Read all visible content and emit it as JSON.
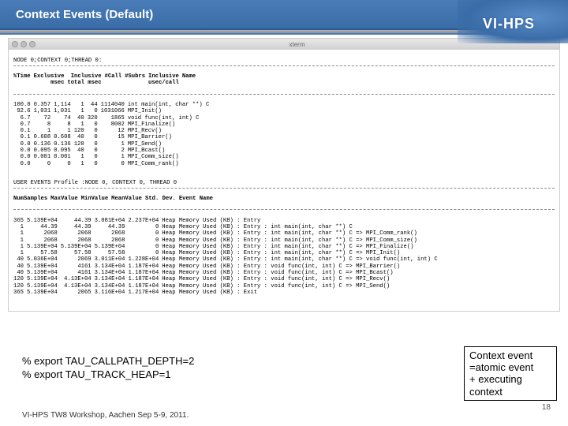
{
  "header": {
    "title": "Context Events (Default)"
  },
  "logo": {
    "text": "VI-HPS"
  },
  "xterm": {
    "window_title": "xterm",
    "node_line": "NODE 0;CONTEXT 0;THREAD 0:",
    "cols1": [
      "%Time",
      "Exclusive",
      "Inclusive",
      "#Call",
      "#Subrs",
      "Inclusive",
      "Name"
    ],
    "cols1b": [
      "",
      "msec",
      "total msec",
      "",
      "",
      "usec/call",
      ""
    ],
    "rows1": [
      [
        "100.0",
        "0.357",
        "1,114",
        "1",
        "44",
        "1114040",
        "int main(int, char **) C"
      ],
      [
        "92.6",
        "1,031",
        "1,031",
        "1",
        "0",
        "1031066",
        "MPI_Init()"
      ],
      [
        "6.7",
        "72",
        "74",
        "40",
        "320",
        "1865",
        "void func(int, int) C"
      ],
      [
        "0.7",
        "8",
        "8",
        "1",
        "0",
        "8002",
        "MPI_Finalize()"
      ],
      [
        "0.1",
        "1",
        "1",
        "120",
        "0",
        "12",
        "MPI_Recv()"
      ],
      [
        "0.1",
        "0.608",
        "0.608",
        "40",
        "0",
        "15",
        "MPI_Barrier()"
      ],
      [
        "0.0",
        "0.136",
        "0.136",
        "120",
        "0",
        "1",
        "MPI_Send()"
      ],
      [
        "0.0",
        "0.095",
        "0.095",
        "40",
        "0",
        "2",
        "MPI_Bcast()"
      ],
      [
        "0.0",
        "0.001",
        "0.001",
        "1",
        "0",
        "1",
        "MPI_Comm_size()"
      ],
      [
        "0.0",
        "0",
        "0",
        "1",
        "0",
        "0",
        "MPI_Comm_rank()"
      ]
    ],
    "user_events_line": "USER EVENTS Profile :NODE 0, CONTEXT 0, THREAD 0",
    "cols2": [
      "NumSamples",
      "MaxValue",
      "MinValue",
      "MeanValue",
      "Std. Dev.",
      "Event Name"
    ],
    "rows2": [
      [
        "365",
        "5.139E+04",
        "44.39",
        "3.081E+04",
        "2.237E+04",
        "Heap Memory Used (KB) : Entry"
      ],
      [
        "1",
        "44.39",
        "44.39",
        "44.39",
        "0",
        "Heap Memory Used (KB) : Entry : int main(int, char **) C"
      ],
      [
        "1",
        "2068",
        "2068",
        "2068",
        "0",
        "Heap Memory Used (KB) : Entry : int main(int, char **) C => MPI_Comm_rank()"
      ],
      [
        "1",
        "2068",
        "2068",
        "2068",
        "0",
        "Heap Memory Used (KB) : Entry : int main(int, char **) C => MPI_Comm_size()"
      ],
      [
        "1",
        "5.139E+04",
        "5.139E+04",
        "5.139E+04",
        "0",
        "Heap Memory Used (KB) : Entry : int main(int, char **) C => MPI_Finalize()"
      ],
      [
        "1",
        "57.58",
        "57.58",
        "57.58",
        "0",
        "Heap Memory Used (KB) : Entry : int main(int, char **) C => MPI_Init()"
      ],
      [
        "40",
        "5.036E+04",
        "2069",
        "3.011E+04",
        "1.228E+04",
        "Heap Memory Used (KB) : Entry : int main(int, char **) C => void func(int, int) C"
      ],
      [
        "40",
        "5.139E+04",
        "4161",
        "3.134E+04",
        "1.187E+04",
        "Heap Memory Used (KB) : Entry : void func(int, int) C => MPI_Barrier()"
      ],
      [
        "40",
        "5.139E+04",
        "4161",
        "3.134E+04",
        "1.187E+04",
        "Heap Memory Used (KB) : Entry : void func(int, int) C => MPI_Bcast()"
      ],
      [
        "120",
        "5.139E+04",
        "4.13E+04",
        "3.134E+04",
        "1.187E+04",
        "Heap Memory Used (KB) : Entry : void func(int, int) C => MPI_Recv()"
      ],
      [
        "120",
        "5.139E+04",
        "4.13E+04",
        "3.134E+04",
        "1.187E+04",
        "Heap Memory Used (KB) : Entry : void func(int, int) C => MPI_Send()"
      ],
      [
        "365",
        "5.139E+04",
        "2065",
        "3.116E+04",
        "1.217E+04",
        "Heap Memory Used (KB) : Exit"
      ]
    ]
  },
  "commands": {
    "line1": "% export TAU_CALLPATH_DEPTH=2",
    "line2": "% export TAU_TRACK_HEAP=1"
  },
  "callout": {
    "l1": "Context event",
    "l2": "=atomic event",
    "l3": "+ executing",
    "l4": "context"
  },
  "footer": {
    "text": "VI-HPS TW8 Workshop, Aachen Sep 5-9, 2011."
  },
  "pagenum": "18"
}
